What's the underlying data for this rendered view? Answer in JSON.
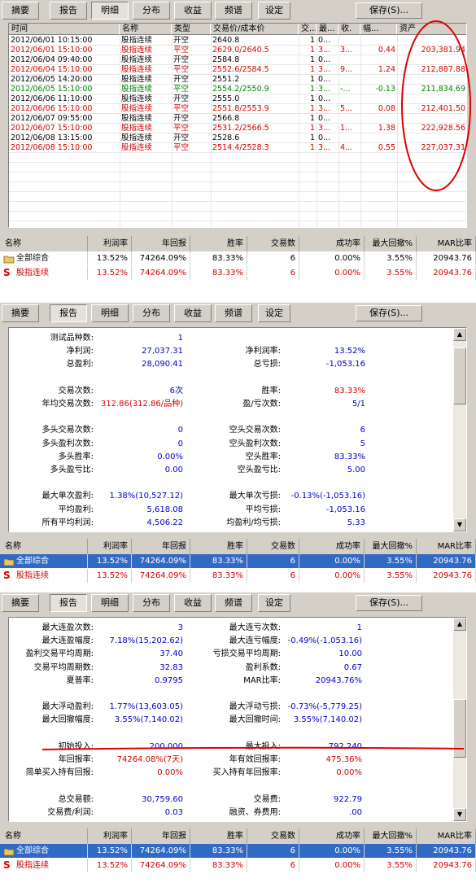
{
  "tabs": [
    "摘要",
    "报告",
    "明细",
    "分布",
    "收益",
    "频谱",
    "设定"
  ],
  "save_label": "保存(S)...",
  "detail": {
    "headers": [
      "时间",
      "名称",
      "类型",
      "交易价/成本价",
      "交...",
      "最...",
      "收.",
      "幅...",
      "资产"
    ],
    "rows": [
      {
        "time": "2012/06/01 10:15:00",
        "name": "股指连续",
        "type": "开空",
        "price": "2640.8",
        "qty": "1",
        "max": "0...",
        "ret": "",
        "amp": "",
        "asset": "",
        "color": "black"
      },
      {
        "time": "2012/06/01 15:10:00",
        "name": "股指连续",
        "type": "平空",
        "price": "2629.0/2640.5",
        "qty": "1",
        "max": "3...",
        "ret": "3...",
        "amp": "0.44",
        "asset": "203,381.94",
        "color": "red"
      },
      {
        "time": "2012/06/04 09:40:00",
        "name": "股指连续",
        "type": "开空",
        "price": "2584.8",
        "qty": "1",
        "max": "0...",
        "ret": "",
        "amp": "",
        "asset": "",
        "color": "black"
      },
      {
        "time": "2012/06/04 15:10:00",
        "name": "股指连续",
        "type": "平空",
        "price": "2552.6/2584.5",
        "qty": "1",
        "max": "3...",
        "ret": "9...",
        "amp": "1.24",
        "asset": "212,887.88",
        "color": "red"
      },
      {
        "time": "2012/06/05 14:20:00",
        "name": "股指连续",
        "type": "开空",
        "price": "2551.2",
        "qty": "1",
        "max": "0...",
        "ret": "",
        "amp": "",
        "asset": "",
        "color": "black"
      },
      {
        "time": "2012/06/05 15:10:00",
        "name": "股指连续",
        "type": "平空",
        "price": "2554.2/2550.9",
        "qty": "1",
        "max": "3...",
        "ret": "-...",
        "amp": "-0.13",
        "asset": "211,834.69",
        "color": "green"
      },
      {
        "time": "2012/06/06 11:10:00",
        "name": "股指连续",
        "type": "开空",
        "price": "2555.0",
        "qty": "1",
        "max": "0...",
        "ret": "",
        "amp": "",
        "asset": "",
        "color": "black"
      },
      {
        "time": "2012/06/06 15:10:00",
        "name": "股指连续",
        "type": "平空",
        "price": "2551.8/2553.9",
        "qty": "1",
        "max": "3...",
        "ret": "5...",
        "amp": "0.08",
        "asset": "212,401.50",
        "color": "red"
      },
      {
        "time": "2012/06/07 09:55:00",
        "name": "股指连续",
        "type": "开空",
        "price": "2566.8",
        "qty": "1",
        "max": "0...",
        "ret": "",
        "amp": "",
        "asset": "",
        "color": "black"
      },
      {
        "time": "2012/06/07 15:10:00",
        "name": "股指连续",
        "type": "平空",
        "price": "2531.2/2566.5",
        "qty": "1",
        "max": "3...",
        "ret": "1...",
        "amp": "1.38",
        "asset": "222,928.56",
        "color": "red"
      },
      {
        "time": "2012/06/08 13:15:00",
        "name": "股指连续",
        "type": "开空",
        "price": "2528.6",
        "qty": "1",
        "max": "0...",
        "ret": "",
        "amp": "",
        "asset": "",
        "color": "black"
      },
      {
        "time": "2012/06/08 15:10:00",
        "name": "股指连续",
        "type": "平空",
        "price": "2514.4/2528.3",
        "qty": "1",
        "max": "3...",
        "ret": "4...",
        "amp": "0.55",
        "asset": "227,037.31",
        "color": "red"
      }
    ]
  },
  "summary": {
    "headers": [
      "名称",
      "利润率",
      "年回报",
      "胜率",
      "交易数",
      "成功率",
      "最大回撤%",
      "MAR比率"
    ],
    "rows": [
      {
        "icon": "folder-icon",
        "name": "全部综合",
        "profit": "13.52%",
        "annual": "74264.09%",
        "win": "83.33%",
        "trades": "6",
        "success": "0.00%",
        "drawdown": "3.55%",
        "mar": "20943.76"
      },
      {
        "icon": "s-icon",
        "name": "股指连续",
        "profit": "13.52%",
        "annual": "74264.09%",
        "win": "83.33%",
        "trades": "6",
        "success": "0.00%",
        "drawdown": "3.55%",
        "mar": "20943.76"
      }
    ]
  },
  "report1": {
    "left": [
      {
        "k": "测试品种数:",
        "v": "1"
      },
      {
        "k": "净利润:",
        "v": "27,037.31"
      },
      {
        "k": "总盈利:",
        "v": "28,090.41"
      },
      {
        "k": "",
        "v": ""
      },
      {
        "k": "交易次数:",
        "v": "6次"
      },
      {
        "k": "年均交易次数:",
        "v": "312.86(312.86/品种)"
      },
      {
        "k": "",
        "v": ""
      },
      {
        "k": "多头交易次数:",
        "v": "0"
      },
      {
        "k": "多头盈利次数:",
        "v": "0"
      },
      {
        "k": "多头胜率:",
        "v": "0.00%"
      },
      {
        "k": "多头盈亏比:",
        "v": "0.00"
      },
      {
        "k": "",
        "v": ""
      },
      {
        "k": "最大单次盈利:",
        "v": "1.38%(10,527.12)"
      },
      {
        "k": "平均盈利:",
        "v": "5,618.08"
      },
      {
        "k": "所有平均利润:",
        "v": "4,506.22"
      }
    ],
    "right": [
      {
        "k": "",
        "v": ""
      },
      {
        "k": "净利润率:",
        "v": "13.52%"
      },
      {
        "k": "总亏损:",
        "v": "-1,053.16"
      },
      {
        "k": "",
        "v": ""
      },
      {
        "k": "胜率:",
        "v": "83.33%"
      },
      {
        "k": "盈/亏次数:",
        "v": "5/1"
      },
      {
        "k": "",
        "v": ""
      },
      {
        "k": "空头交易次数:",
        "v": "6"
      },
      {
        "k": "空头盈利次数:",
        "v": "5"
      },
      {
        "k": "空头胜率:",
        "v": "83.33%"
      },
      {
        "k": "空头盈亏比:",
        "v": "5.00"
      },
      {
        "k": "",
        "v": ""
      },
      {
        "k": "最大单次亏损:",
        "v": "-0.13%(-1,053.16)"
      },
      {
        "k": "平均亏损:",
        "v": "-1,053.16"
      },
      {
        "k": "均盈利/均亏损:",
        "v": "5.33"
      }
    ]
  },
  "report2": {
    "left": [
      {
        "k": "最大连盈次数:",
        "v": "3"
      },
      {
        "k": "最大连盈幅度:",
        "v": "7.18%(15,202.62)"
      },
      {
        "k": "盈利交易平均周期:",
        "v": "37.40"
      },
      {
        "k": "交易平均周期数:",
        "v": "32.83"
      },
      {
        "k": "夏普率:",
        "v": "0.9795"
      },
      {
        "k": "",
        "v": ""
      },
      {
        "k": "最大浮动盈利:",
        "v": "1.77%(13,603.05)"
      },
      {
        "k": "最大回撤幅度:",
        "v": "3.55%(7,140.02)"
      },
      {
        "k": "",
        "v": ""
      },
      {
        "k": "初始投入:",
        "v": "200,000"
      },
      {
        "k": "年回报率:",
        "v": "74264.08%(7天)"
      },
      {
        "k": "简单买入持有回报:",
        "v": "0.00%"
      },
      {
        "k": "",
        "v": ""
      },
      {
        "k": "总交易额:",
        "v": "30,759.60"
      },
      {
        "k": "交易费/利润:",
        "v": "0.03"
      }
    ],
    "right": [
      {
        "k": "最大连亏次数:",
        "v": "1"
      },
      {
        "k": "最大连亏幅度:",
        "v": "-0.49%(-1,053.16)"
      },
      {
        "k": "亏损交易平均周期:",
        "v": "10.00"
      },
      {
        "k": "盈利系数:",
        "v": "0.67"
      },
      {
        "k": "MAR比率:",
        "v": "20943.76%"
      },
      {
        "k": "",
        "v": ""
      },
      {
        "k": "最大浮动亏损:",
        "v": "-0.73%(-5,779.25)"
      },
      {
        "k": "最大回撤时间:",
        "v": "3.55%(7,140.02)"
      },
      {
        "k": "",
        "v": ""
      },
      {
        "k": "最大投入:",
        "v": "792,240"
      },
      {
        "k": "年有效回报率:",
        "v": "475.36%"
      },
      {
        "k": "买入持有年回报率:",
        "v": "0.00%"
      },
      {
        "k": "",
        "v": ""
      },
      {
        "k": "交易费:",
        "v": "922.79"
      },
      {
        "k": "融资、券费用:",
        "v": ".00"
      }
    ]
  },
  "colors": {
    "red": "#d40000",
    "green": "#008000",
    "blue": "#0000cc",
    "selection": "#316ac5",
    "annotation": "#e00000"
  }
}
